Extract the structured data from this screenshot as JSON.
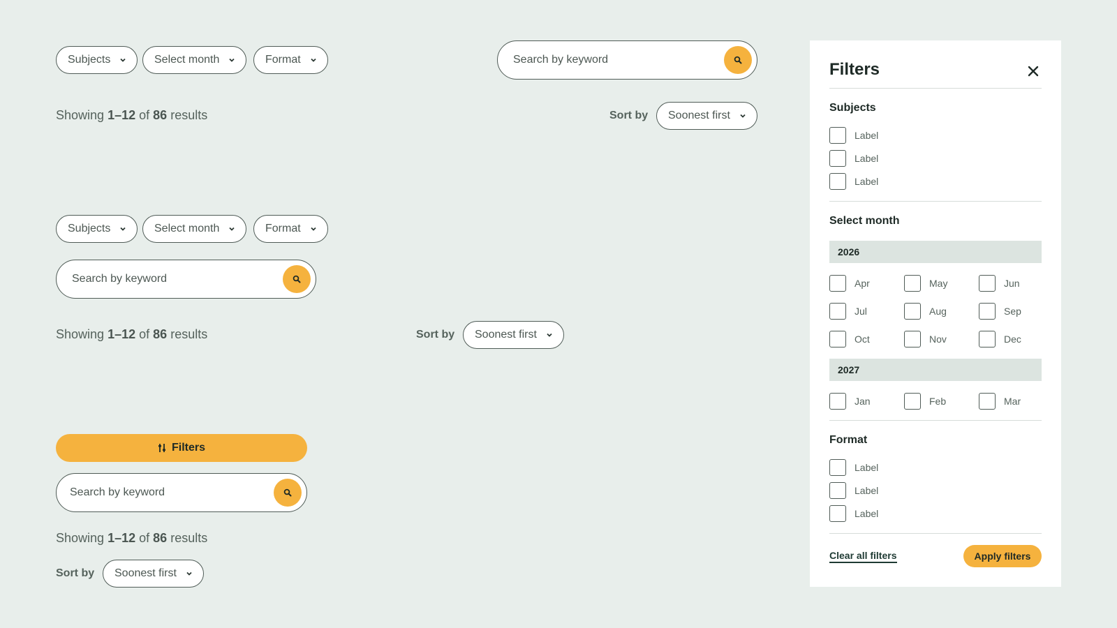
{
  "filter_chips": {
    "subjects": "Subjects",
    "month": "Select month",
    "format": "Format"
  },
  "search": {
    "placeholder": "Search by keyword"
  },
  "results": {
    "prefix": "Showing",
    "range": "1–12",
    "of": "of",
    "total": "86",
    "suffix": "results"
  },
  "sort": {
    "label": "Sort by",
    "value": "Soonest first"
  },
  "filters_button": {
    "label": "Filters"
  },
  "panel": {
    "title": "Filters",
    "subjects": {
      "heading": "Subjects",
      "options": [
        "Label",
        "Label",
        "Label"
      ]
    },
    "month": {
      "heading": "Select month",
      "years": [
        {
          "year": "2026",
          "months": [
            "Apr",
            "May",
            "Jun",
            "Jul",
            "Aug",
            "Sep",
            "Oct",
            "Nov",
            "Dec"
          ]
        },
        {
          "year": "2027",
          "months": [
            "Jan",
            "Feb",
            "Mar"
          ]
        }
      ]
    },
    "format": {
      "heading": "Format",
      "options": [
        "Label",
        "Label",
        "Label"
      ]
    },
    "clear_label": "Clear all filters",
    "apply_label": "Apply filters"
  },
  "colors": {
    "background": "#e8eeeb",
    "accent": "#f5b23e",
    "year_bar": "#dce4e0",
    "border": "#4f5b56"
  }
}
